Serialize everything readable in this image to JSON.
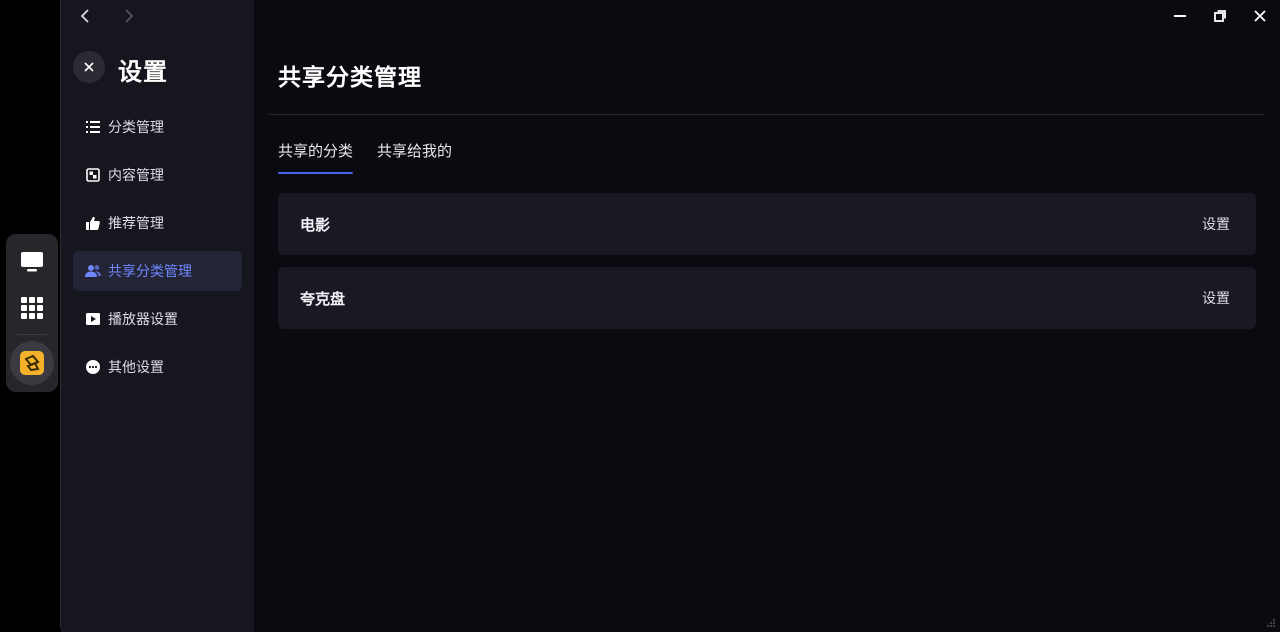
{
  "dock": {
    "items": [
      {
        "icon": "monitor-icon"
      },
      {
        "icon": "apps-grid-icon"
      },
      {
        "icon": "app-logo-icon"
      }
    ]
  },
  "sidebar": {
    "title": "设置",
    "items": [
      {
        "label": "分类管理",
        "icon": "list-icon"
      },
      {
        "label": "内容管理",
        "icon": "content-icon"
      },
      {
        "label": "推荐管理",
        "icon": "thumbs-up-icon"
      },
      {
        "label": "共享分类管理",
        "icon": "share-users-icon",
        "active": true
      },
      {
        "label": "播放器设置",
        "icon": "play-icon"
      },
      {
        "label": "其他设置",
        "icon": "more-icon"
      }
    ]
  },
  "main": {
    "title": "共享分类管理",
    "tabs": [
      {
        "label": "共享的分类",
        "active": true
      },
      {
        "label": "共享给我的"
      }
    ],
    "rows": [
      {
        "name": "电影",
        "action": "设置"
      },
      {
        "name": "夸克盘",
        "action": "设置"
      }
    ]
  },
  "colors": {
    "accent": "#4a63e8",
    "active_text": "#6f86ff",
    "background": "#0b0a10",
    "sidebar": "#16161e",
    "row": "#191923"
  }
}
